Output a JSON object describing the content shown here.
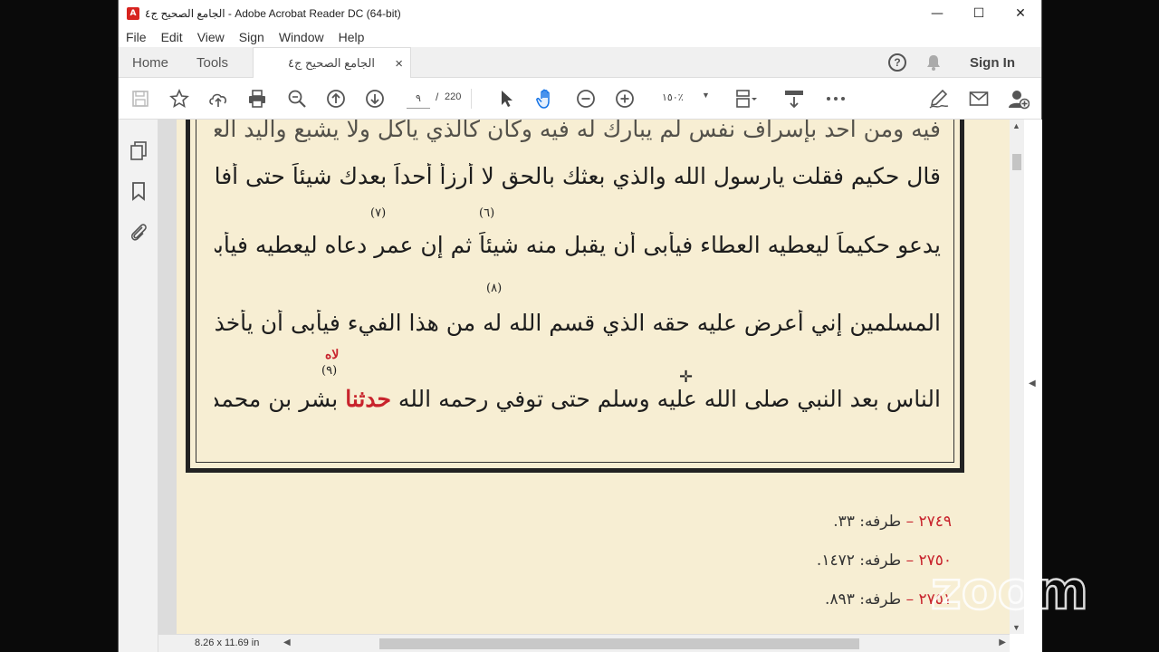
{
  "window": {
    "title": "الجامع الصحيح ج٤ - Adobe Acrobat Reader DC (64-bit)",
    "app_icon_label": "A",
    "minimize": "—",
    "maximize": "☐",
    "close": "✕"
  },
  "menu": [
    "File",
    "Edit",
    "View",
    "Sign",
    "Window",
    "Help"
  ],
  "tabs": {
    "home": "Home",
    "tools": "Tools",
    "document": "الجامع الصحيح ج٤",
    "close": "×",
    "help": "?",
    "sign_in": "Sign In"
  },
  "toolbar": {
    "current_page": "٩",
    "page_separator": "/",
    "total_pages": "220",
    "zoom": "١٥٠٪",
    "zoom_caret": "▼",
    "icons": [
      "save-icon",
      "bookmark-star-icon",
      "upload-icon",
      "print-icon",
      "search-zoom-icon",
      "prev-page-icon",
      "next-page-icon",
      "select-cursor-icon",
      "hand-tool-icon",
      "zoom-out-icon",
      "zoom-in-icon",
      "page-fit-icon",
      "scroll-mode-icon",
      "more-icon",
      "sign-pen-icon",
      "email-icon",
      "add-user-icon"
    ]
  },
  "left_panel": {
    "icons": [
      "pages-icon",
      "bookmark-icon",
      "attachment-icon"
    ],
    "collapse_arrow": "◀"
  },
  "right_panel": {
    "expand_arrow": "◀"
  },
  "document": {
    "lines": [
      "فيه ومن أحد بإسراف نفس لم يبارك له فيه وكان كالذي يأكل ولا يشبع واليد العليا خير من اليد السفلى",
      "قال حكيم فقلت يارسول الله والذي بعثك بالحق لا أرزأ أحداً بعدك شيئاً حتى أفارق الدنيا فكان أبو بكر",
      "يدعو حكيماً ليعطيه العطاء فيأبى أن يقبل منه شيئاً ثم إن عمر دعاه ليعطيه فيأبى أن يقبله فقال يا معشر",
      "المسلمين إني أعرض عليه حقه الذي قسم الله له من هذا الفيء فيأبى أن يأخذه فلم يرزأ حكيم أحداً من",
      "الناس بعد النبي صلى الله عليه وسلم حتى توفي رحمه الله"
    ],
    "last_line_red": "حدثنا",
    "last_line_end": "بشر بن محمد السختياني أخبرنا",
    "notes": [
      "(٦)",
      "(٧)",
      "(٨)",
      "(٩)"
    ],
    "red_note": "لاه",
    "footnotes": [
      {
        "num": "٢٧٤٩ –",
        "text": "طرفه: ٣٣."
      },
      {
        "num": "٢٧٥٠ –",
        "text": "طرفه: ١٤٧٢."
      },
      {
        "num": "٢٧٥١ –",
        "text": "طرفه: ٨٩٣."
      }
    ],
    "cursor": "✛"
  },
  "scroll": {
    "up": "▲",
    "down": "▼",
    "left": "◀",
    "right": "▶"
  },
  "status": {
    "page_size": "8.26 x 11.69 in"
  },
  "watermark": "zoom",
  "colors": {
    "page_bg": "#f7eed3",
    "accent_red": "#c8232c",
    "acrobat_red": "#d7231f",
    "hand_tool_blue": "#1473e6"
  }
}
